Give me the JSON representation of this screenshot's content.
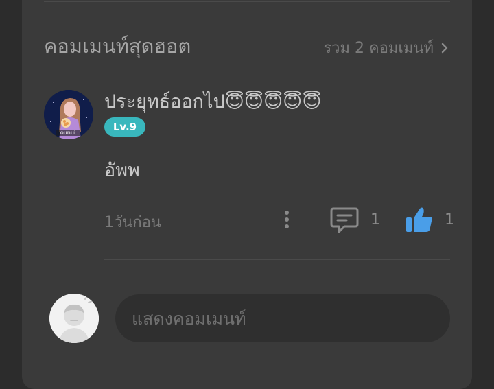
{
  "hot_comments": {
    "title": "คอมเมนท์สุดฮอต",
    "total_label": "รวม 2 คอมเมนท์"
  },
  "comment": {
    "username": "ประยุทธ์ออกไป😇😇😇😇😇",
    "level": "Lv.9",
    "text": "อัพพ",
    "time": "1วันก่อน",
    "reply_count": "1",
    "like_count": "1",
    "avatar_text": "ounui"
  },
  "composer": {
    "placeholder": "แสดงคอมเมนท์"
  },
  "colors": {
    "card_bg": "#3a3a3a",
    "page_bg": "#2c2c2c",
    "level_badge": "#39b7bd",
    "like_icon": "#4a9ee8"
  }
}
